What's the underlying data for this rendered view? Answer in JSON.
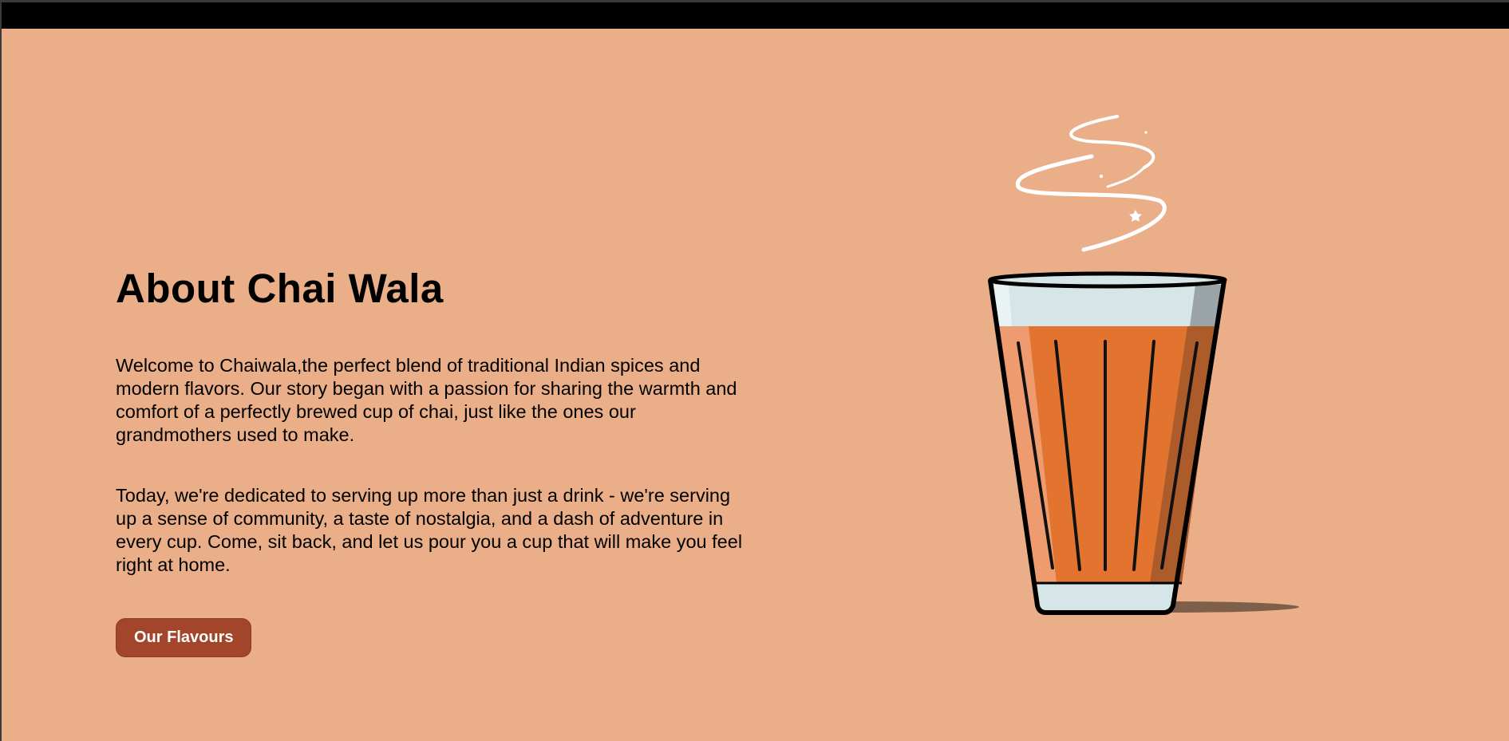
{
  "about": {
    "title": "About Chai Wala",
    "paragraphs": [
      "Welcome to Chaiwala,the perfect blend of traditional Indian spices and modern flavors. Our story began with a passion for sharing the warmth and comfort of a perfectly brewed cup of chai, just like the ones our grandmothers used to make.",
      "Today, we're dedicated to serving up more than just a drink - we're serving up a sense of community, a taste of nostalgia, and a dash of adventure in every cup. Come, sit back, and let us pour you a cup that will make you feel right at home."
    ],
    "cta_label": "Our Flavours"
  },
  "colors": {
    "page_background": "#EAAF89",
    "top_bar": "#000000",
    "button_background": "#A3452A",
    "button_text": "#FFFFFF",
    "chai": "#E2742F",
    "glass": "#D6E6E8",
    "steam": "#FFFFFF"
  },
  "illustration": {
    "icon": "chai-glass-icon",
    "steam_icon": "steam-icon"
  }
}
